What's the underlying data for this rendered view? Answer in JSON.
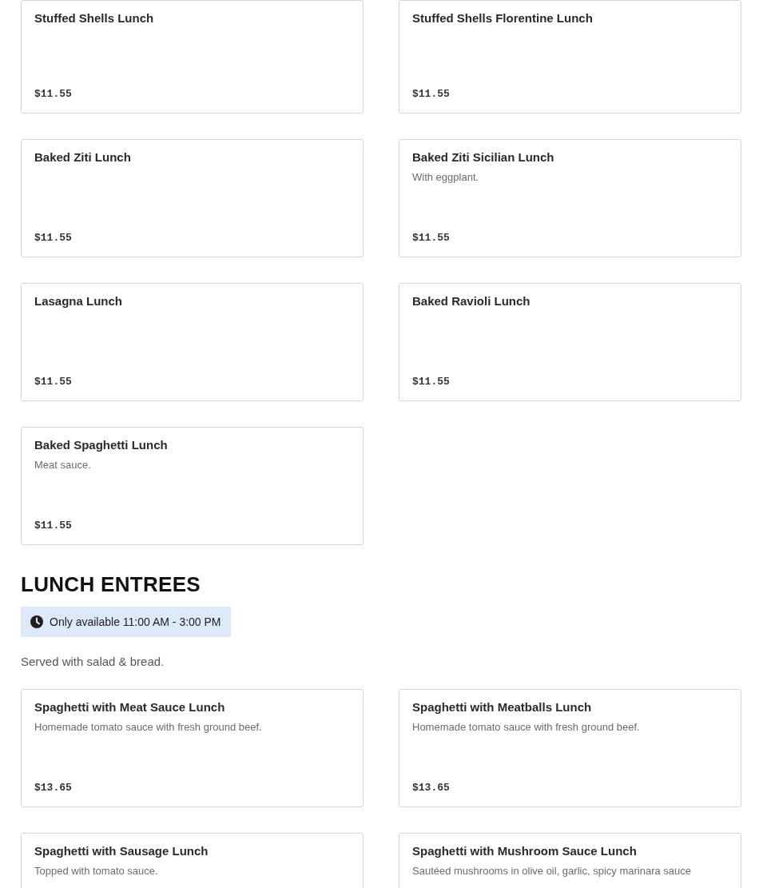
{
  "sections": [
    {
      "items": [
        {
          "name": "Stuffed Shells Lunch",
          "price": "$11.55"
        },
        {
          "name": "Stuffed Shells Florentine Lunch",
          "price": "$11.55"
        },
        {
          "name": "Baked Ziti Lunch",
          "price": "$11.55"
        },
        {
          "name": "Baked Ziti Sicilian Lunch",
          "description": "With eggplant.",
          "price": "$11.55"
        },
        {
          "name": "Lasagna Lunch",
          "price": "$11.55"
        },
        {
          "name": "Baked Ravioli Lunch",
          "price": "$11.55"
        },
        {
          "name": "Baked Spaghetti Lunch",
          "description": "Meat sauce.",
          "price": "$11.55"
        }
      ]
    },
    {
      "title": "LUNCH ENTREES",
      "availability": "Only available 11:00 AM - 3:00 PM",
      "description": "Served with salad & bread.",
      "items": [
        {
          "name": "Spaghetti with Meat Sauce Lunch",
          "description": "Homemade tomato sauce with fresh ground beef.",
          "price": "$13.65"
        },
        {
          "name": "Spaghetti with Meatballs Lunch",
          "description": "Homemade tomato sauce with fresh ground beef.",
          "price": "$13.65"
        },
        {
          "name": "Spaghetti with Sausage Lunch",
          "description": "Topped with tomato sauce."
        },
        {
          "name": "Spaghetti with Mushroom Sauce Lunch",
          "description": "Sautéed mushrooms in olive oil, garlic, spicy marinara sauce"
        }
      ]
    }
  ]
}
